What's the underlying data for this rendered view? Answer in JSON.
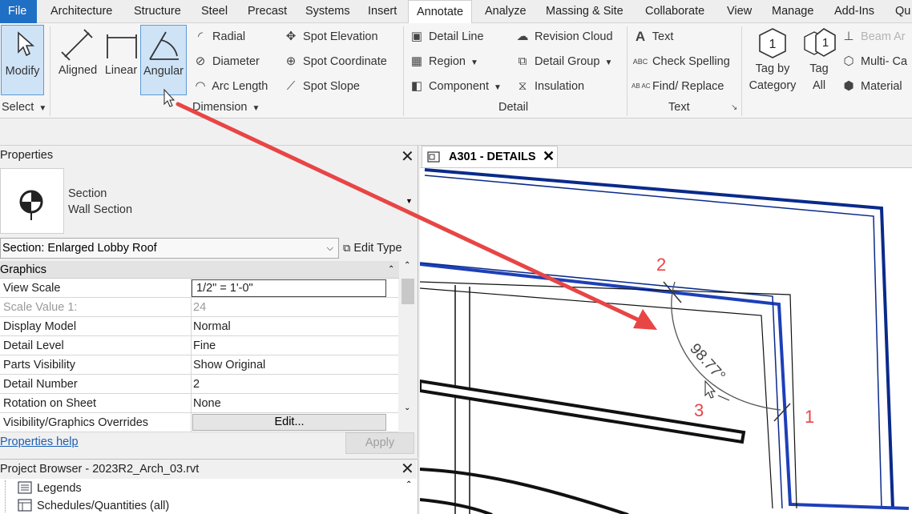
{
  "menu": {
    "tabs": [
      "File",
      "Architecture",
      "Structure",
      "Steel",
      "Precast",
      "Systems",
      "Insert",
      "Annotate",
      "Analyze",
      "Massing & Site",
      "Collaborate",
      "View",
      "Manage",
      "Add-Ins",
      "Qu"
    ],
    "active": "Annotate"
  },
  "ribbon": {
    "select": {
      "modify_label": "Modify",
      "panel_title": "Select"
    },
    "dimension": {
      "panel_title": "Dimension",
      "aligned": "Aligned",
      "linear": "Linear",
      "angular": "Angular",
      "radial": "Radial",
      "diameter": "Diameter",
      "arc_length": "Arc  Length",
      "spot_elevation": "Spot  Elevation",
      "spot_coordinate": "Spot  Coordinate",
      "spot_slope": "Spot  Slope"
    },
    "detail": {
      "panel_title": "Detail",
      "detail_line": "Detail  Line",
      "region": "Region",
      "component": "Component",
      "revision_cloud": "Revision  Cloud",
      "detail_group": "Detail  Group",
      "insulation": "Insulation"
    },
    "text": {
      "panel_title": "Text",
      "text": "Text",
      "check_spelling": "Check  Spelling",
      "find_replace": "Find/  Replace",
      "abc_glyph": "ABC",
      "abc_glyph_small": "AB AC",
      "a_glyph": "A"
    },
    "tag": {
      "tag_by_category_line1": "Tag by",
      "tag_by_category_line2": "Category",
      "tag_all_line1": "Tag",
      "tag_all_line2": "All",
      "tag_digit": "1",
      "beam_annotations": "Beam  Ar",
      "multi_category": "Multi-  Ca",
      "material": "Material"
    }
  },
  "properties": {
    "title": "Properties",
    "type_line1": "Section",
    "type_line2": "Wall Section",
    "selector_value": "Section: Enlarged Lobby Roof",
    "edit_type": "Edit Type",
    "group": "Graphics",
    "rows": [
      {
        "name": "View Scale",
        "value": "1/2\" = 1'-0\""
      },
      {
        "name": "Scale Value    1:",
        "value": "24"
      },
      {
        "name": "Display Model",
        "value": "Normal"
      },
      {
        "name": "Detail Level",
        "value": "Fine"
      },
      {
        "name": "Parts Visibility",
        "value": "Show Original"
      },
      {
        "name": "Detail Number",
        "value": "2"
      },
      {
        "name": "Rotation on Sheet",
        "value": "None"
      },
      {
        "name": "Visibility/Graphics Overrides",
        "value": "Edit..."
      }
    ],
    "help_link": "Properties help",
    "apply": "Apply"
  },
  "project_browser": {
    "title": "Project Browser - 2023R2_Arch_03.rvt",
    "items": [
      "Legends",
      "Schedules/Quantities (all)"
    ]
  },
  "view": {
    "tab_title": "A301 - DETAILS",
    "dimension_text": "98.77°",
    "pick_labels": [
      "1",
      "2",
      "3"
    ]
  },
  "colors": {
    "accent": "#1f6fc5",
    "selected_button": "#cfe3f7",
    "annotation_red": "#e84545",
    "wall_blue": "#0a2a8a"
  }
}
